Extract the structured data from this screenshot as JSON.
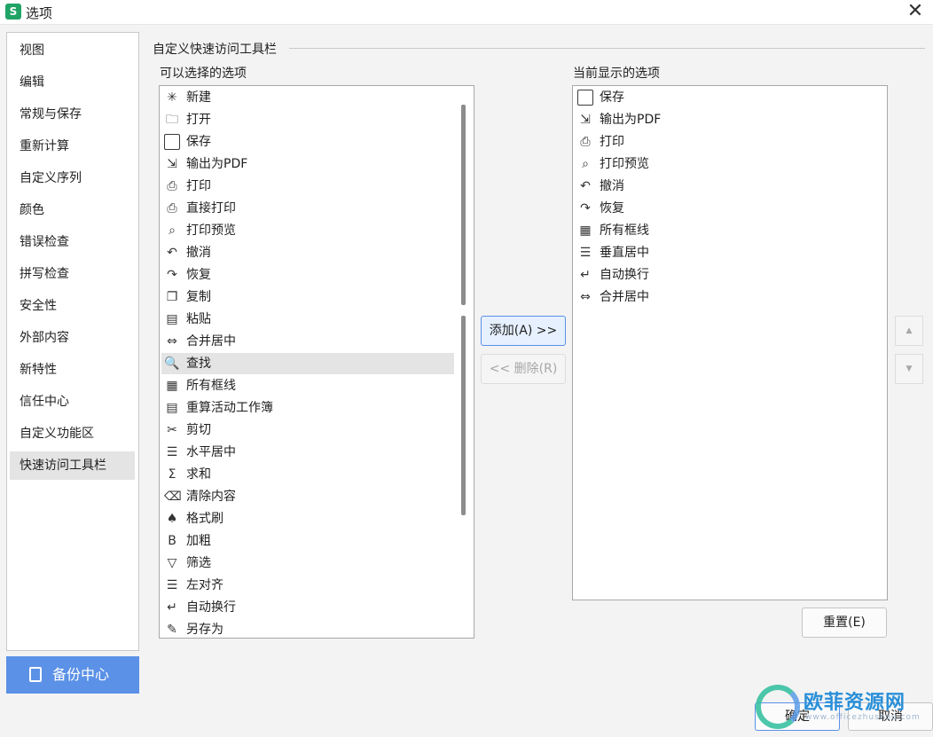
{
  "window": {
    "title": "选项",
    "app_icon_letter": "S",
    "close_glyph": "✕"
  },
  "sidebar": {
    "items": [
      {
        "label": "视图"
      },
      {
        "label": "编辑"
      },
      {
        "label": "常规与保存"
      },
      {
        "label": "重新计算"
      },
      {
        "label": "自定义序列"
      },
      {
        "label": "颜色"
      },
      {
        "label": "错误检查"
      },
      {
        "label": "拼写检查"
      },
      {
        "label": "安全性"
      },
      {
        "label": "外部内容"
      },
      {
        "label": "新特性"
      },
      {
        "label": "信任中心"
      },
      {
        "label": "自定义功能区"
      },
      {
        "label": "快速访问工具栏",
        "active": true
      }
    ],
    "backup_label": "备份中心"
  },
  "panel": {
    "section_title": "自定义快速访问工具栏",
    "available_label": "可以选择的选项",
    "current_label": "当前显示的选项",
    "available_items": [
      {
        "label": "新建",
        "icon": "new-file-icon",
        "glyph": "✳"
      },
      {
        "label": "打开",
        "icon": "open-folder-icon",
        "glyph": "🗀"
      },
      {
        "label": "保存",
        "icon": "save-icon",
        "glyph": ""
      },
      {
        "label": "输出为PDF",
        "icon": "export-pdf-icon",
        "glyph": "⇲"
      },
      {
        "label": "打印",
        "icon": "print-icon",
        "glyph": "⎙"
      },
      {
        "label": "直接打印",
        "icon": "direct-print-icon",
        "glyph": "⎙"
      },
      {
        "label": "打印预览",
        "icon": "print-preview-icon",
        "glyph": "⌕"
      },
      {
        "label": "撤消",
        "icon": "undo-icon",
        "glyph": "↶"
      },
      {
        "label": "恢复",
        "icon": "redo-icon",
        "glyph": "↷"
      },
      {
        "label": "复制",
        "icon": "copy-icon",
        "glyph": "❐"
      },
      {
        "label": "粘贴",
        "icon": "paste-icon",
        "glyph": "▤"
      },
      {
        "label": "合并居中",
        "icon": "merge-center-icon",
        "glyph": "⇔"
      },
      {
        "label": "查找",
        "icon": "find-icon",
        "glyph": "🔍",
        "highlighted": true
      },
      {
        "label": "所有框线",
        "icon": "all-borders-icon",
        "glyph": "▦"
      },
      {
        "label": "重算活动工作簿",
        "icon": "recalculate-icon",
        "glyph": "▤"
      },
      {
        "label": "剪切",
        "icon": "cut-icon",
        "glyph": "✂"
      },
      {
        "label": "水平居中",
        "icon": "align-center-icon",
        "glyph": "☰"
      },
      {
        "label": "求和",
        "icon": "sum-icon",
        "glyph": "Σ"
      },
      {
        "label": "清除内容",
        "icon": "clear-content-icon",
        "glyph": "⌫"
      },
      {
        "label": "格式刷",
        "icon": "format-painter-icon",
        "glyph": "♠"
      },
      {
        "label": "加粗",
        "icon": "bold-icon",
        "glyph": "B"
      },
      {
        "label": "筛选",
        "icon": "filter-icon",
        "glyph": "▽"
      },
      {
        "label": "左对齐",
        "icon": "align-left-icon",
        "glyph": "☰"
      },
      {
        "label": "自动换行",
        "icon": "wrap-text-icon",
        "glyph": "↵"
      },
      {
        "label": "另存为",
        "icon": "save-as-icon",
        "glyph": "✎"
      }
    ],
    "current_items": [
      {
        "label": "保存",
        "icon": "save-icon",
        "glyph": ""
      },
      {
        "label": "输出为PDF",
        "icon": "export-pdf-icon",
        "glyph": "⇲"
      },
      {
        "label": "打印",
        "icon": "print-icon",
        "glyph": "⎙"
      },
      {
        "label": "打印预览",
        "icon": "print-preview-icon",
        "glyph": "⌕"
      },
      {
        "label": "撤消",
        "icon": "undo-icon",
        "glyph": "↶"
      },
      {
        "label": "恢复",
        "icon": "redo-icon",
        "glyph": "↷"
      },
      {
        "label": "所有框线",
        "icon": "all-borders-icon",
        "glyph": "▦"
      },
      {
        "label": "垂直居中",
        "icon": "vertical-center-icon",
        "glyph": "☰"
      },
      {
        "label": "自动换行",
        "icon": "wrap-text-icon",
        "glyph": "↵"
      },
      {
        "label": "合并居中",
        "icon": "merge-center-icon",
        "glyph": "⇔"
      }
    ],
    "add_label": "添加(A) >>",
    "remove_label": "<< 删除(R)",
    "move_up_glyph": "▲",
    "move_down_glyph": "▼",
    "reset_label": "重置(E)"
  },
  "footer": {
    "ok_label": "确定",
    "cancel_label": "取消"
  },
  "watermark": {
    "text": "欧菲资源网",
    "url": "www.officezhushou.com"
  },
  "colors": {
    "accent": "#5b91e6",
    "selected_bg": "#e4e4e4"
  }
}
